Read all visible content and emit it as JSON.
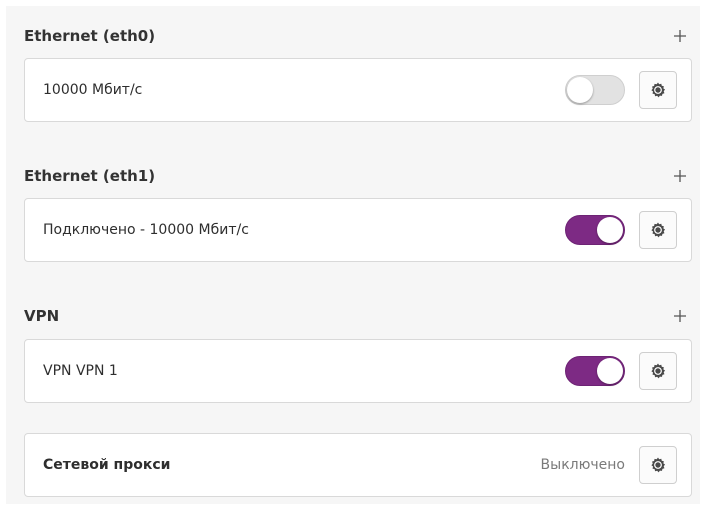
{
  "sections": [
    {
      "title": "Ethernet (eth0)",
      "add_icon": "plus-icon",
      "connection": {
        "label": "10000 Мбит/с",
        "toggle_on": false,
        "settings_icon": "gear-icon"
      }
    },
    {
      "title": "Ethernet (eth1)",
      "add_icon": "plus-icon",
      "connection": {
        "label": "Подключено - 10000 Мбит/с",
        "toggle_on": true,
        "settings_icon": "gear-icon"
      }
    },
    {
      "title": "VPN",
      "add_icon": "plus-icon",
      "connection": {
        "label": "VPN VPN 1",
        "toggle_on": true,
        "settings_icon": "gear-icon"
      }
    }
  ],
  "proxy": {
    "label": "Сетевой прокси",
    "status": "Выключено",
    "settings_icon": "gear-icon"
  },
  "colors": {
    "toggle_on": "#7d2a84",
    "toggle_off": "#e2e2e2",
    "panel_bg": "#f6f6f6"
  }
}
